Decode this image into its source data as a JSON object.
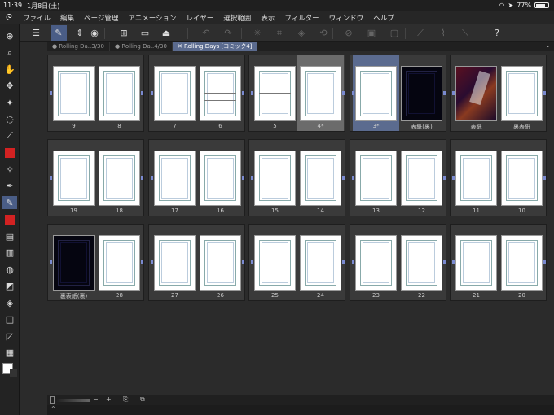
{
  "status": {
    "time": "11:39",
    "date": "1月8日(土)",
    "battery": "77%",
    "battery_level": 0.77
  },
  "menu": [
    "ファイル",
    "編集",
    "ページ管理",
    "アニメーション",
    "レイヤー",
    "選択範囲",
    "表示",
    "フィルター",
    "ウィンドウ",
    "ヘルプ"
  ],
  "tabs": [
    {
      "label": "Rolling Da..3/30",
      "active": false
    },
    {
      "label": "Rolling Da..4/30",
      "active": false
    },
    {
      "label": "Rolling Days [コミック4]",
      "active": true
    }
  ],
  "tab_close": "✕",
  "toolbar_icons": [
    "menu-icon",
    "edit-icon",
    "chevron-updown-icon",
    "camera-icon",
    "new-page-icon",
    "open-icon",
    "export-icon",
    "undo-icon",
    "redo-icon",
    "transform-icon",
    "crop-icon",
    "fill-icon",
    "rotate-icon",
    "hide-icon",
    "layer-icon",
    "select-icon",
    "pen-icon",
    "brush-icon",
    "eraser-icon",
    "help-icon"
  ],
  "tools": [
    "select-tool",
    "zoom-tool",
    "hand-tool",
    "move-tool",
    "magic-wand-tool",
    "lasso-tool",
    "eyedropper-tool",
    "color-red",
    "sparkle-tool",
    "pen-tool",
    "pencil-tool",
    "color-red-2",
    "brush-tool",
    "stamp-tool",
    "fill-tool",
    "eraser-tool",
    "bucket-tool",
    "rect-tool",
    "triangle-tool",
    "gradient-tool",
    "main-color",
    "sub-color"
  ],
  "rows": [
    [
      {
        "pages": [
          {
            "label": "9"
          },
          {
            "label": "8"
          }
        ]
      },
      {
        "pages": [
          {
            "label": "7"
          },
          {
            "label": "6",
            "cuts": 2
          }
        ]
      },
      {
        "pages": [
          {
            "label": "5",
            "cuts": 1
          },
          {
            "label": "4*",
            "highlight": true
          }
        ]
      },
      {
        "pages": [
          {
            "label": "3*",
            "selected": true
          },
          {
            "label": "表紙(裏)",
            "dark": true
          }
        ]
      },
      {
        "pages": [
          {
            "label": "表紙",
            "cover": true
          },
          {
            "label": "裏表紙"
          }
        ]
      }
    ],
    [
      {
        "pages": [
          {
            "label": "19"
          },
          {
            "label": "18"
          }
        ]
      },
      {
        "pages": [
          {
            "label": "17"
          },
          {
            "label": "16"
          }
        ]
      },
      {
        "pages": [
          {
            "label": "15"
          },
          {
            "label": "14"
          }
        ]
      },
      {
        "pages": [
          {
            "label": "13"
          },
          {
            "label": "12"
          }
        ]
      },
      {
        "pages": [
          {
            "label": "11"
          },
          {
            "label": "10"
          }
        ]
      }
    ],
    [
      {
        "pages": [
          {
            "label": "裏表紙(裏)",
            "dark": true
          },
          {
            "label": "28"
          }
        ]
      },
      {
        "pages": [
          {
            "label": "27"
          },
          {
            "label": "26"
          }
        ]
      },
      {
        "pages": [
          {
            "label": "25"
          },
          {
            "label": "24"
          }
        ]
      },
      {
        "pages": [
          {
            "label": "23"
          },
          {
            "label": "22"
          }
        ]
      },
      {
        "pages": [
          {
            "label": "21"
          },
          {
            "label": "20"
          }
        ]
      }
    ]
  ],
  "bottom": {
    "minus": "−",
    "plus": "+",
    "link": "⎘",
    "page_btn": "⧉"
  },
  "colors": {
    "accent": "#5b6b8f",
    "red_swatch": "#d32222"
  }
}
